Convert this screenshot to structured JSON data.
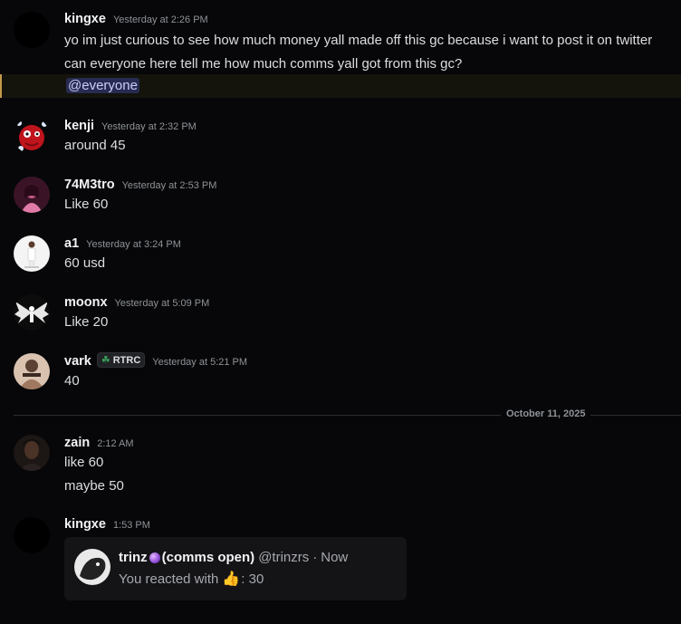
{
  "messages": [
    {
      "user": "kingxe",
      "time": "Yesterday at 2:26 PM",
      "lines": [
        "yo im just curious to see how much money yall made off this gc because i want to post it on twitter",
        "can everyone here tell me how much comms yall got from this gc?"
      ],
      "mention": "@everyone"
    },
    {
      "user": "kenji",
      "time": "Yesterday at 2:32 PM",
      "text": "around 45"
    },
    {
      "user": "74M3tro",
      "time": "Yesterday at 2:53 PM",
      "text": "Like 60"
    },
    {
      "user": "a1",
      "time": "Yesterday at 3:24 PM",
      "text": "60 usd"
    },
    {
      "user": "moonx",
      "time": "Yesterday at 5:09 PM",
      "text": "Like 20"
    },
    {
      "user": "vark",
      "tag": "RTRC",
      "time": "Yesterday at 5:21 PM",
      "text": "40"
    },
    {
      "user": "zain",
      "time": "2:12 AM",
      "lines": [
        "like 60",
        "maybe 50"
      ]
    },
    {
      "user": "kingxe",
      "time": "1:53 PM"
    }
  ],
  "divider": {
    "label": "October 11, 2025"
  },
  "embed": {
    "name_prefix": "trinz",
    "name_suffix": "(comms open)",
    "handle": "@trinzrs",
    "separator": "·",
    "time": "Now",
    "reaction_prefix": "You reacted with",
    "reaction_emoji": "👍",
    "reaction_value": ": 30"
  },
  "colors": {
    "background": "#070709",
    "mention_bg": "#14130c",
    "mention_bar": "#c49a4b",
    "mention_text": "#c9cdfb",
    "tag_icon": "#3ba55d"
  },
  "icons": [
    "dark-circle-avatar",
    "red-creature-avatar",
    "pink-silhouette-avatar",
    "white-figure-avatar",
    "winged-angel-avatar",
    "pale-figure-avatar",
    "dark-portrait-avatar",
    "guild-tag-plant-icon",
    "purple-orb-emoji",
    "thumbs-up-emoji"
  ]
}
